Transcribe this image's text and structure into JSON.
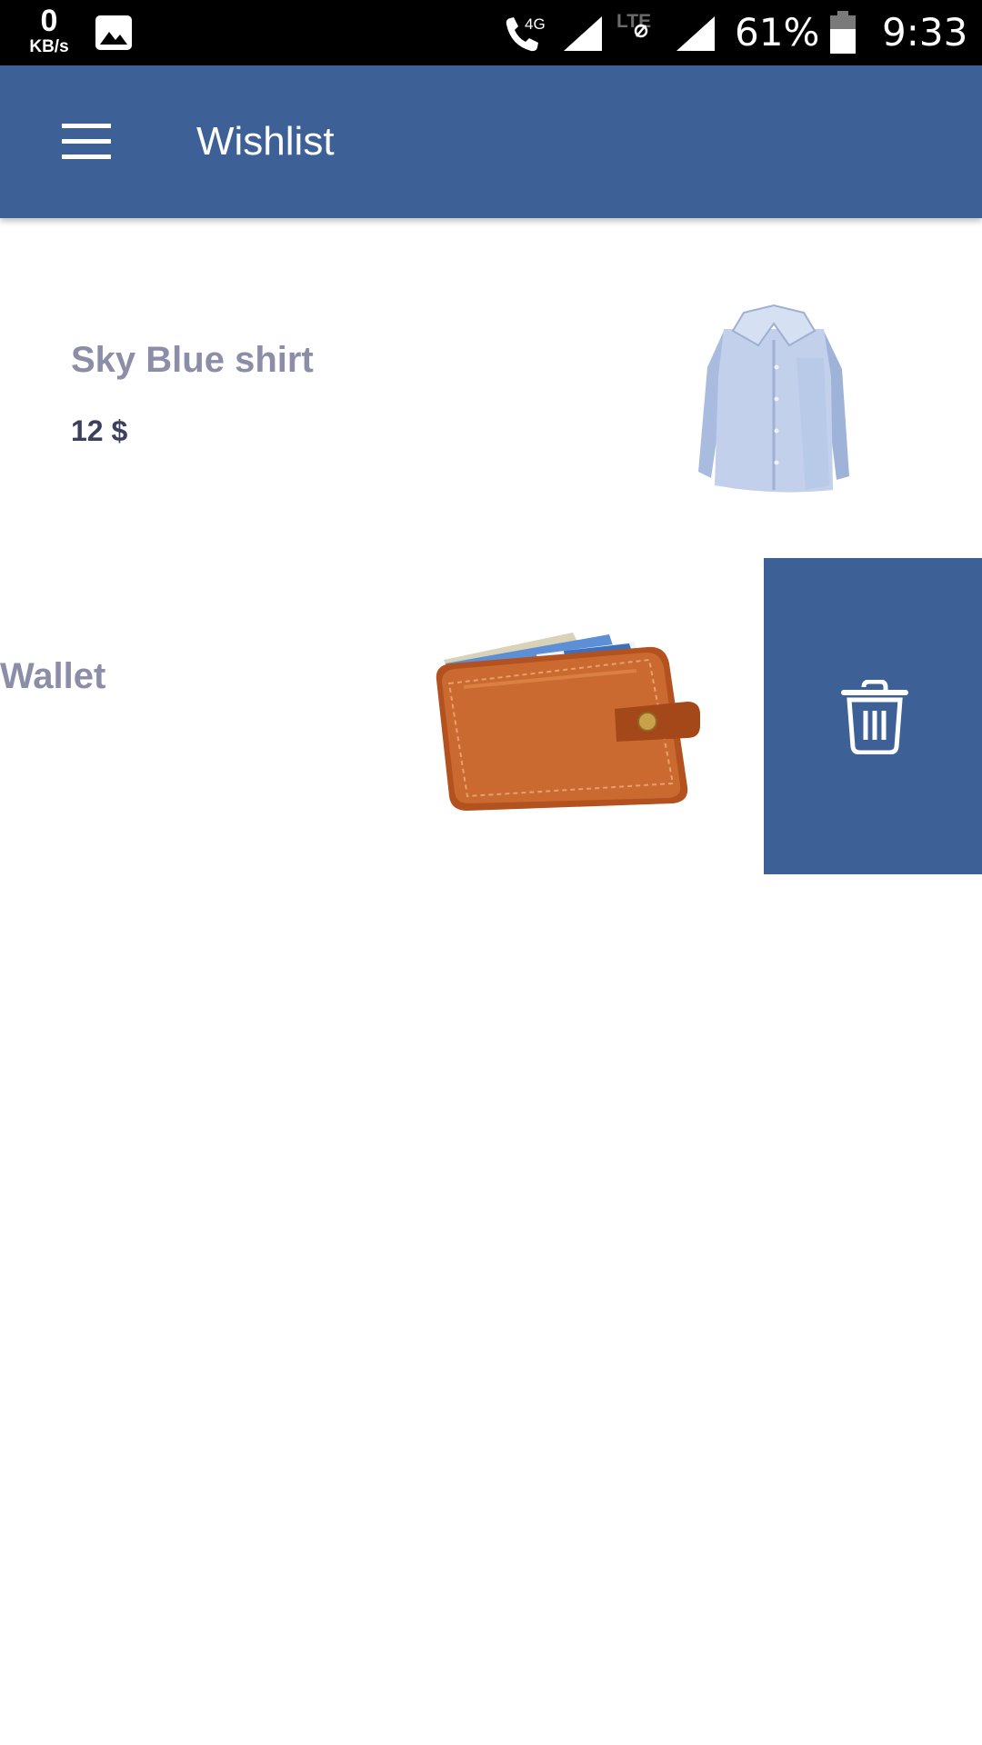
{
  "status_bar": {
    "net_speed_value": "0",
    "net_speed_unit": "KB/s",
    "network_type": "4G",
    "lte_label": "LTE",
    "battery_percent": "61%",
    "time": "9:33",
    "icons": [
      "gallery-icon",
      "call-4g-icon",
      "signal-icon",
      "lte-icon",
      "signal-icon",
      "battery-icon"
    ]
  },
  "app_bar": {
    "title": "Wishlist",
    "menu_icon": "hamburger-menu-icon",
    "color": "#3d6096"
  },
  "wishlist": {
    "items": [
      {
        "name": "Sky Blue shirt",
        "price": "12 $",
        "image": "blue-shirt"
      },
      {
        "name": "Wallet",
        "price": "",
        "image": "leather-wallet"
      }
    ],
    "swipe_action": {
      "icon": "trash-icon",
      "color": "#3d6096"
    }
  },
  "colors": {
    "accent": "#3d6096",
    "item_name": "#8c8ea8",
    "item_price": "#3c3f5e"
  }
}
